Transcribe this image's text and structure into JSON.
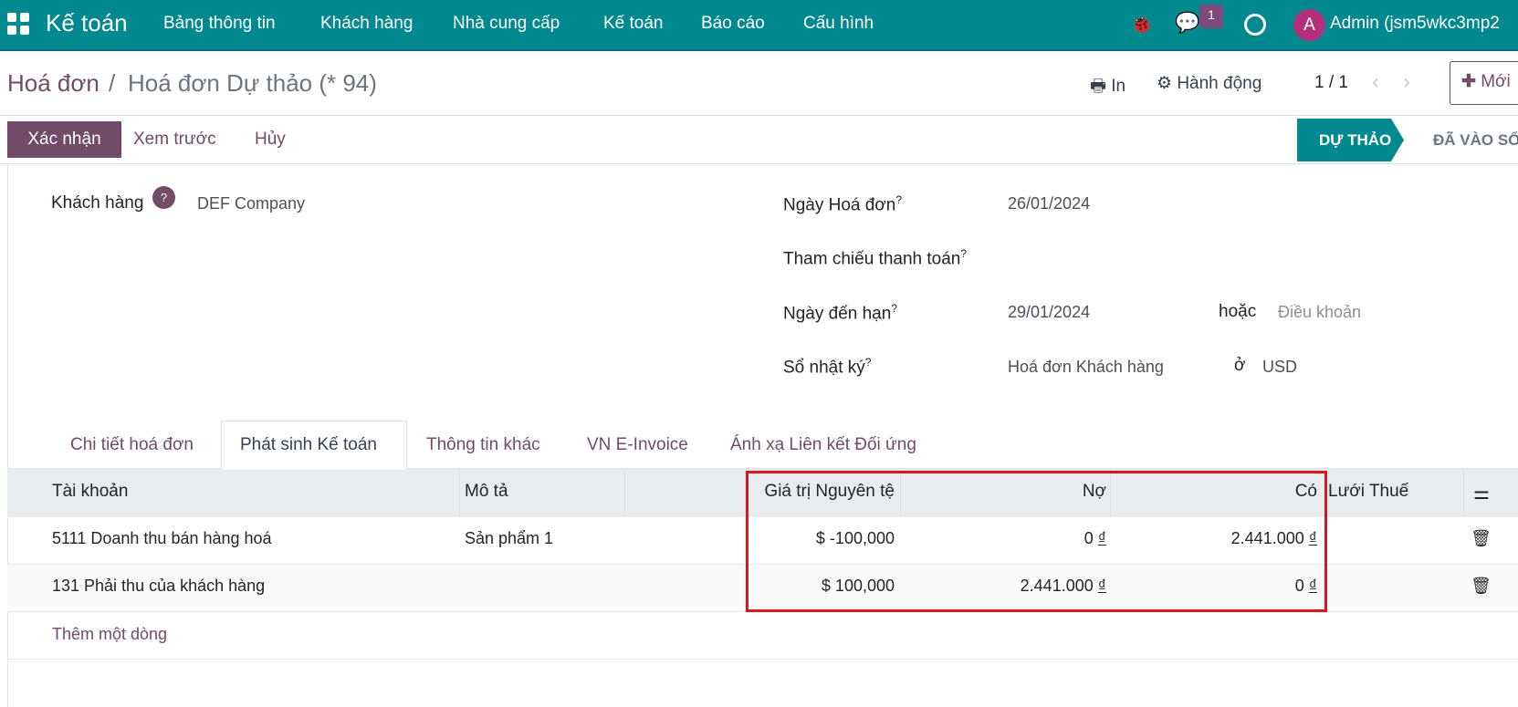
{
  "navbar": {
    "app_name": "Kế toán",
    "menu": [
      "Bảng thông tin",
      "Khách hàng",
      "Nhà cung cấp",
      "Kế toán",
      "Báo cáo",
      "Cấu hình"
    ],
    "message_count": "1",
    "avatar_letter": "A",
    "user": "Admin (jsm5wkc3mp2",
    "color": "#01898f"
  },
  "breadcrumb": {
    "parent": "Hoá đơn",
    "current": "Hoá đơn Dự thảo (* 94)"
  },
  "toolbar": {
    "print": "In",
    "action": "Hành động",
    "pager": "1 / 1",
    "new": "Mới"
  },
  "buttons": {
    "confirm": "Xác nhận",
    "preview": "Xem trước",
    "cancel": "Hủy"
  },
  "status": {
    "draft": "DỰ THẢO",
    "posted": "ĐÃ VÀO SỔ"
  },
  "form": {
    "customer_label": "Khách hàng",
    "customer_value": "DEF Company",
    "invoice_date_label": "Ngày Hoá đơn",
    "invoice_date": "26/01/2024",
    "payment_ref_label": "Tham chiếu thanh toán",
    "due_date_label": "Ngày đến hạn",
    "due_date": "29/01/2024",
    "or": "hoặc",
    "terms_placeholder": "Điều khoản",
    "journal_label": "Sổ nhật ký",
    "journal": "Hoá đơn Khách hàng",
    "in": "ở",
    "currency": "USD",
    "help": "?"
  },
  "tabs": [
    "Chi tiết hoá đơn",
    "Phát sinh Kế toán",
    "Thông tin khác",
    "VN E-Invoice",
    "Ánh xạ Liên kết Đối ứng"
  ],
  "table": {
    "headers": [
      "Tài khoản",
      "Mô tả",
      "Giá trị Nguyên tệ",
      "Nợ",
      "Có",
      "Lưới Thuế"
    ],
    "rows": [
      {
        "account": "5111 Doanh thu bán hàng hoá",
        "label": "Sản phẩm 1",
        "amount": "$ -100,000",
        "debit": "0",
        "credit": "2.441.000"
      },
      {
        "account": "131 Phải thu của khách hàng",
        "label": "",
        "amount": "$ 100,000",
        "debit": "2.441.000",
        "credit": "0"
      }
    ],
    "currency_symbol": "₫",
    "add_line": "Thêm một dòng"
  },
  "highlight_color": "#e0161b"
}
